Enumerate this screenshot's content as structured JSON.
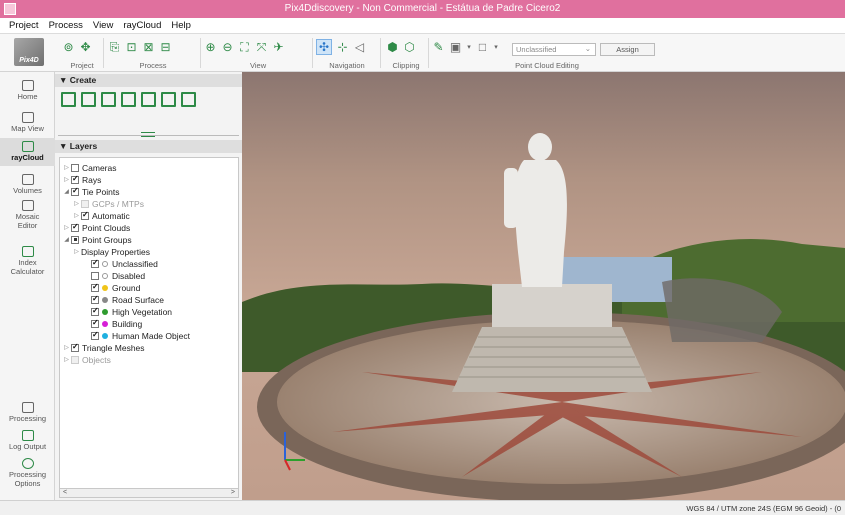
{
  "window": {
    "title": "Pix4Ddiscovery - Non Commercial - Estátua de Padre Cicero2"
  },
  "menu": [
    "Project",
    "Process",
    "View",
    "rayCloud",
    "Help"
  ],
  "ribbon": {
    "logo_text": "Pix4D",
    "groups": [
      "Project",
      "Process",
      "View",
      "Navigation",
      "Clipping",
      "Point Cloud Editing"
    ],
    "class_dropdown": "Unclassified",
    "assign_label": "Assign"
  },
  "leftbar": {
    "items": [
      "Home",
      "Map View",
      "rayCloud",
      "Volumes",
      "Mosaic Editor",
      "Index Calculator",
      "Processing",
      "Log Output",
      "Processing Options"
    ]
  },
  "panel": {
    "create_header": "Create",
    "layers_header": "Layers"
  },
  "layers": [
    {
      "label": "Cameras",
      "state": "unchecked",
      "arrow": "closed"
    },
    {
      "label": "Rays",
      "state": "checked",
      "arrow": "closed"
    },
    {
      "label": "Tie Points",
      "state": "checked",
      "arrow": "open"
    },
    {
      "label": "GCPs / MTPs",
      "state": "disabled",
      "arrow": "closed"
    },
    {
      "label": "Automatic",
      "state": "checked",
      "arrow": "closed"
    },
    {
      "label": "Point Clouds",
      "state": "checked",
      "arrow": "closed"
    },
    {
      "label": "Point Groups",
      "state": "partial",
      "arrow": "open"
    },
    {
      "label": "Display Properties",
      "state": "none",
      "arrow": "closed"
    },
    {
      "label": "Unclassified",
      "state": "checked",
      "dot": "hollow"
    },
    {
      "label": "Disabled",
      "state": "unchecked",
      "dot": "hollow"
    },
    {
      "label": "Ground",
      "state": "checked",
      "dot": "#f0c419"
    },
    {
      "label": "Road Surface",
      "state": "checked",
      "dot": "#888888"
    },
    {
      "label": "High Vegetation",
      "state": "checked",
      "dot": "#2e9b2e"
    },
    {
      "label": "Building",
      "state": "checked",
      "dot": "#d61fd6"
    },
    {
      "label": "Human Made Object",
      "state": "checked",
      "dot": "#1fb0e0"
    },
    {
      "label": "Triangle Meshes",
      "state": "checked",
      "arrow": "closed"
    },
    {
      "label": "Objects",
      "state": "disabled",
      "arrow": "closed"
    }
  ],
  "status": {
    "coordinate_system": "WGS 84 / UTM zone 24S (EGM 96 Geoid) - (0"
  },
  "colors": {
    "titlebar": "#e0709e",
    "accent": "#2e8a47"
  }
}
